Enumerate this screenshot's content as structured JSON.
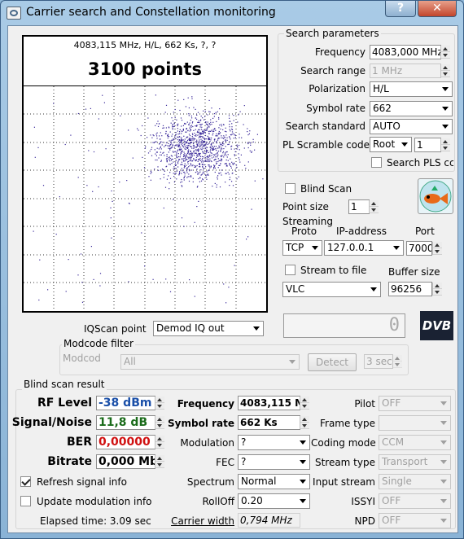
{
  "window": {
    "title": "Carrier search and Constellation monitoring",
    "help": "?",
    "close": "✕"
  },
  "constellation": {
    "info": "4083,115 MHz, H/L, 662 Ks, ?, ?",
    "points": "3100 points"
  },
  "search_params": {
    "legend": "Search parameters",
    "frequency_label": "Frequency",
    "frequency": "4083,000 MHz",
    "range_label": "Search range",
    "range": "1 MHz",
    "pol_label": "Polarization",
    "pol": "H/L",
    "sr_label": "Symbol rate",
    "sr": "662",
    "std_label": "Search standard",
    "std": "AUTO",
    "pls_label": "PL Scramble code",
    "pls_mode": "Root",
    "pls_value": "1",
    "search_pls_label": "Search PLS cc"
  },
  "blind": {
    "label": "Blind Scan",
    "point_size_label": "Point size",
    "point_size": "1"
  },
  "streaming": {
    "label": "Streaming",
    "proto_label": "Proto",
    "ip_label": "IP-address",
    "port_label": "Port",
    "proto": "TCP",
    "ip": "127.0.0.1",
    "port": "7000",
    "stream_file_label": "Stream to file",
    "buffer_label": "Buffer size",
    "player": "VLC",
    "buffer": "96256"
  },
  "iq": {
    "label": "IQScan point",
    "value": "Demod IQ out",
    "lcd": "0"
  },
  "modcode": {
    "legend": "Modcode filter",
    "label": "Modcode",
    "value": "All",
    "detect": "Detect",
    "seconds": "3 sec"
  },
  "logo": "DVB",
  "result": {
    "legend": "Blind scan result",
    "rf_label": "RF Level",
    "rf": "-38 dBm",
    "sn_label": "Signal/Noise",
    "sn": "11,8 dB",
    "ber_label": "BER",
    "ber": "0,00000",
    "br_label": "Bitrate",
    "br": "0,000 Mb",
    "freq_label": "Frequency",
    "freq": "4083,115 M",
    "sr_label": "Symbol rate",
    "sr": "662 Ks",
    "mod_label": "Modulation",
    "mod": "?",
    "fec_label": "FEC",
    "fec": "?",
    "spec_label": "Spectrum",
    "spec": "Normal",
    "roll_label": "RollOff",
    "roll": "0.20",
    "cw_label": "Carrier width",
    "cw": "0,794 MHz",
    "pilot_label": "Pilot",
    "pilot": "OFF",
    "frame_label": "Frame type",
    "frame": "",
    "coding_label": "Coding mode",
    "coding": "CCM",
    "stype_label": "Stream type",
    "stype": "Transport",
    "istream_label": "Input stream",
    "istream": "Single",
    "issyi_label": "ISSYI",
    "issyi": "OFF",
    "npd_label": "NPD",
    "npd": "OFF",
    "refresh_label": "Refresh signal info",
    "update_label": "Update modulation info",
    "elapsed": "Elapsed time: 3.09 sec"
  },
  "colors": {
    "rf": "#1a4fa8",
    "sn": "#1a6b1a",
    "ber": "#d01010",
    "accent_title": "#3a5f86"
  }
}
